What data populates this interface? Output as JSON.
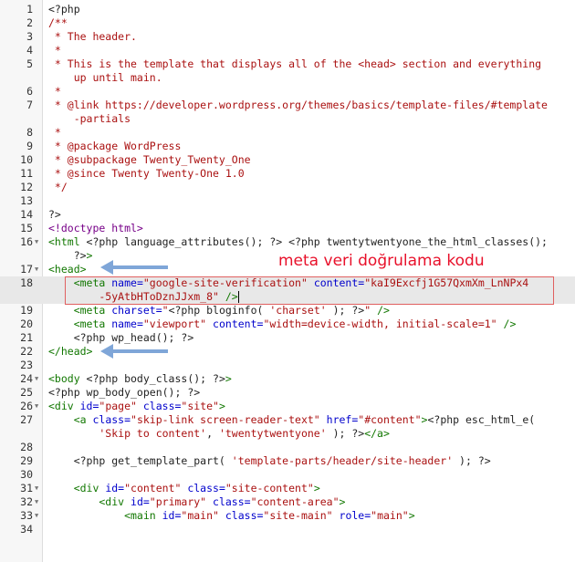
{
  "editor": {
    "active_line": 18,
    "lines": [
      {
        "n": "1",
        "fold": "",
        "segs": [
          {
            "c": "ph",
            "t": "<?php"
          }
        ]
      },
      {
        "n": "2",
        "fold": "",
        "segs": [
          {
            "c": "cm",
            "t": "/**"
          }
        ]
      },
      {
        "n": "3",
        "fold": "",
        "segs": [
          {
            "c": "cm",
            "t": " * The header."
          }
        ]
      },
      {
        "n": "4",
        "fold": "",
        "segs": [
          {
            "c": "cm",
            "t": " *"
          }
        ]
      },
      {
        "n": "5",
        "fold": "",
        "segs": [
          {
            "c": "cm",
            "t": " * This is the template that displays all of the <head> section and everything"
          }
        ]
      },
      {
        "n": "",
        "fold": "",
        "segs": [
          {
            "c": "cm",
            "t": "    up until main."
          }
        ]
      },
      {
        "n": "6",
        "fold": "",
        "segs": [
          {
            "c": "cm",
            "t": " *"
          }
        ]
      },
      {
        "n": "7",
        "fold": "",
        "segs": [
          {
            "c": "cm",
            "t": " * @link https://developer.wordpress.org/themes/basics/template-files/#template"
          }
        ]
      },
      {
        "n": "",
        "fold": "",
        "segs": [
          {
            "c": "cm",
            "t": "    -partials"
          }
        ]
      },
      {
        "n": "8",
        "fold": "",
        "segs": [
          {
            "c": "cm",
            "t": " *"
          }
        ]
      },
      {
        "n": "9",
        "fold": "",
        "segs": [
          {
            "c": "cm",
            "t": " * @package WordPress"
          }
        ]
      },
      {
        "n": "10",
        "fold": "",
        "segs": [
          {
            "c": "cm",
            "t": " * @subpackage Twenty_Twenty_One"
          }
        ]
      },
      {
        "n": "11",
        "fold": "",
        "segs": [
          {
            "c": "cm",
            "t": " * @since Twenty Twenty-One 1.0"
          }
        ]
      },
      {
        "n": "12",
        "fold": "",
        "segs": [
          {
            "c": "cm",
            "t": " */"
          }
        ]
      },
      {
        "n": "13",
        "fold": "",
        "segs": [
          {
            "c": "ph",
            "t": ""
          }
        ]
      },
      {
        "n": "14",
        "fold": "",
        "segs": [
          {
            "c": "ph",
            "t": "?>"
          }
        ]
      },
      {
        "n": "15",
        "fold": "",
        "segs": [
          {
            "c": "kw",
            "t": "<!doctype html>"
          }
        ]
      },
      {
        "n": "16",
        "fold": "▼",
        "segs": [
          {
            "c": "tg",
            "t": "<html "
          },
          {
            "c": "ph",
            "t": "<?php language_attributes(); ?> <?php twentytwentyone_the_html_classes();"
          }
        ]
      },
      {
        "n": "",
        "fold": "",
        "segs": [
          {
            "c": "ph",
            "t": "    ?>"
          },
          {
            "c": "tg",
            "t": ">"
          }
        ]
      },
      {
        "n": "17",
        "fold": "▼",
        "segs": [
          {
            "c": "tg",
            "t": "<head>"
          }
        ]
      },
      {
        "n": "18",
        "fold": "",
        "segs": [
          {
            "c": "tg",
            "t": "    <meta "
          },
          {
            "c": "at",
            "t": "name="
          },
          {
            "c": "st",
            "t": "\"google-site-verification\""
          },
          {
            "c": "at",
            "t": " content="
          },
          {
            "c": "st",
            "t": "\"kaI9Excfj1G57QxmXm_LnNPx4"
          }
        ]
      },
      {
        "n": "",
        "fold": "",
        "segs": [
          {
            "c": "st",
            "t": "        -5yAtbHToDznJJxm_8\""
          },
          {
            "c": "tg",
            "t": " />"
          }
        ],
        "cursor": true
      },
      {
        "n": "19",
        "fold": "",
        "segs": [
          {
            "c": "tg",
            "t": "    <meta "
          },
          {
            "c": "at",
            "t": "charset="
          },
          {
            "c": "st",
            "t": "\""
          },
          {
            "c": "ph",
            "t": "<?php bloginfo( "
          },
          {
            "c": "st",
            "t": "'charset'"
          },
          {
            "c": "ph",
            "t": " ); ?>"
          },
          {
            "c": "st",
            "t": "\""
          },
          {
            "c": "tg",
            "t": " />"
          }
        ]
      },
      {
        "n": "20",
        "fold": "",
        "segs": [
          {
            "c": "tg",
            "t": "    <meta "
          },
          {
            "c": "at",
            "t": "name="
          },
          {
            "c": "st",
            "t": "\"viewport\""
          },
          {
            "c": "at",
            "t": " content="
          },
          {
            "c": "st",
            "t": "\"width=device-width, initial-scale=1\""
          },
          {
            "c": "tg",
            "t": " />"
          }
        ]
      },
      {
        "n": "21",
        "fold": "",
        "segs": [
          {
            "c": "ph",
            "t": "    <?php wp_head(); ?>"
          }
        ]
      },
      {
        "n": "22",
        "fold": "",
        "segs": [
          {
            "c": "tg",
            "t": "</head>"
          }
        ]
      },
      {
        "n": "23",
        "fold": "",
        "segs": [
          {
            "c": "ph",
            "t": ""
          }
        ]
      },
      {
        "n": "24",
        "fold": "▼",
        "segs": [
          {
            "c": "tg",
            "t": "<body "
          },
          {
            "c": "ph",
            "t": "<?php body_class(); ?>"
          },
          {
            "c": "tg",
            "t": ">"
          }
        ]
      },
      {
        "n": "25",
        "fold": "",
        "segs": [
          {
            "c": "ph",
            "t": "<?php wp_body_open(); ?>"
          }
        ]
      },
      {
        "n": "26",
        "fold": "▼",
        "segs": [
          {
            "c": "tg",
            "t": "<div "
          },
          {
            "c": "at",
            "t": "id="
          },
          {
            "c": "st",
            "t": "\"page\""
          },
          {
            "c": "at",
            "t": " class="
          },
          {
            "c": "st",
            "t": "\"site\""
          },
          {
            "c": "tg",
            "t": ">"
          }
        ]
      },
      {
        "n": "27",
        "fold": "",
        "segs": [
          {
            "c": "tg",
            "t": "    <a "
          },
          {
            "c": "at",
            "t": "class="
          },
          {
            "c": "st",
            "t": "\"skip-link screen-reader-text\""
          },
          {
            "c": "at",
            "t": " href="
          },
          {
            "c": "st",
            "t": "\"#content\""
          },
          {
            "c": "tg",
            "t": ">"
          },
          {
            "c": "ph",
            "t": "<?php esc_html_e("
          }
        ]
      },
      {
        "n": "",
        "fold": "",
        "segs": [
          {
            "c": "st",
            "t": "        'Skip to content'"
          },
          {
            "c": "ph",
            "t": ", "
          },
          {
            "c": "st",
            "t": "'twentytwentyone'"
          },
          {
            "c": "ph",
            "t": " ); ?>"
          },
          {
            "c": "tg",
            "t": "</a>"
          }
        ]
      },
      {
        "n": "28",
        "fold": "",
        "segs": [
          {
            "c": "ph",
            "t": ""
          }
        ]
      },
      {
        "n": "29",
        "fold": "",
        "segs": [
          {
            "c": "ph",
            "t": "    <?php get_template_part( "
          },
          {
            "c": "st",
            "t": "'template-parts/header/site-header'"
          },
          {
            "c": "ph",
            "t": " ); ?>"
          }
        ]
      },
      {
        "n": "30",
        "fold": "",
        "segs": [
          {
            "c": "ph",
            "t": ""
          }
        ]
      },
      {
        "n": "31",
        "fold": "▼",
        "segs": [
          {
            "c": "tg",
            "t": "    <div "
          },
          {
            "c": "at",
            "t": "id="
          },
          {
            "c": "st",
            "t": "\"content\""
          },
          {
            "c": "at",
            "t": " class="
          },
          {
            "c": "st",
            "t": "\"site-content\""
          },
          {
            "c": "tg",
            "t": ">"
          }
        ]
      },
      {
        "n": "32",
        "fold": "▼",
        "segs": [
          {
            "c": "tg",
            "t": "        <div "
          },
          {
            "c": "at",
            "t": "id="
          },
          {
            "c": "st",
            "t": "\"primary\""
          },
          {
            "c": "at",
            "t": " class="
          },
          {
            "c": "st",
            "t": "\"content-area\""
          },
          {
            "c": "tg",
            "t": ">"
          }
        ]
      },
      {
        "n": "33",
        "fold": "▼",
        "segs": [
          {
            "c": "tg",
            "t": "            <main "
          },
          {
            "c": "at",
            "t": "id="
          },
          {
            "c": "st",
            "t": "\"main\""
          },
          {
            "c": "at",
            "t": " class="
          },
          {
            "c": "st",
            "t": "\"site-main\""
          },
          {
            "c": "at",
            "t": " role="
          },
          {
            "c": "st",
            "t": "\"main\""
          },
          {
            "c": "tg",
            "t": ">"
          }
        ]
      },
      {
        "n": "34",
        "fold": "",
        "segs": [
          {
            "c": "ph",
            "t": ""
          }
        ]
      }
    ]
  },
  "annotation": {
    "label": "meta veri doğrulama kodu",
    "color": "#e8102a",
    "arrow_color": "#7fa6d8"
  }
}
